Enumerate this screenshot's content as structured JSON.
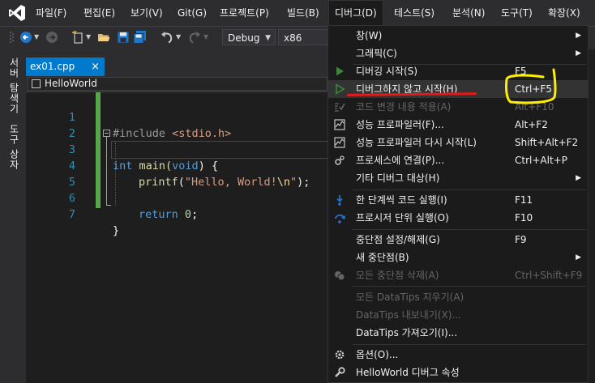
{
  "menubar": {
    "items": [
      "파일(F)",
      "편집(E)",
      "보기(V)",
      "Git(G)",
      "프로젝트(P)",
      "빌드(B)",
      "디버그(D)",
      "테스트(S)",
      "분석(N)",
      "도구(T)",
      "확장(X)"
    ],
    "active": "디버그(D)"
  },
  "toolbar": {
    "configuration": "Debug",
    "platform": "x86"
  },
  "side_panels": [
    "서버 탐색기",
    "도구 상자"
  ],
  "editor": {
    "tab_name": "ex01.cpp",
    "tab_close": "×",
    "scope": "HelloWorld",
    "line_numbers": [
      "1",
      "2",
      "3",
      "4",
      "5",
      "6",
      "7"
    ],
    "code": {
      "l1_directive": "#include ",
      "l1_header": "<stdio.h>",
      "l3_type": "int",
      "l3_name": " main(",
      "l3_void": "void",
      "l3_rest": ") {",
      "l4_fn": "printf",
      "l4_open": "(",
      "l4_str": "\"Hello, World!",
      "l4_esc": "\\n",
      "l4_strend": "\"",
      "l4_close": ");",
      "l6_ret": "return",
      "l6_num": "0",
      "l6_semi": ";",
      "l7": "}"
    }
  },
  "debug_menu": {
    "items": [
      {
        "label": "창(W)",
        "shortcut": "",
        "submenu": true,
        "disabled": false,
        "icon": ""
      },
      {
        "label": "그래픽(C)",
        "shortcut": "",
        "submenu": true,
        "disabled": false,
        "icon": ""
      },
      {
        "label": "디버깅 시작(S)",
        "shortcut": "F5",
        "submenu": false,
        "disabled": false,
        "icon": "play-icon"
      },
      {
        "label": "디버그하지 않고 시작(H)",
        "shortcut": "Ctrl+F5",
        "submenu": false,
        "disabled": false,
        "icon": "play-outline-icon",
        "highlighted": true
      },
      {
        "label": "코드 변경 내용 적용(A)",
        "shortcut": "Alt+F10",
        "submenu": false,
        "disabled": true,
        "icon": "apply-changes-icon"
      },
      {
        "label": "성능 프로파일러(F)...",
        "shortcut": "Alt+F2",
        "submenu": false,
        "disabled": false,
        "icon": "profiler-icon"
      },
      {
        "label": "성능 프로파일러 다시 시작(L)",
        "shortcut": "Shift+Alt+F2",
        "submenu": false,
        "disabled": false,
        "icon": "profiler-relaunch-icon"
      },
      {
        "label": "프로세스에 연결(P)...",
        "shortcut": "Ctrl+Alt+P",
        "submenu": false,
        "disabled": false,
        "icon": "attach-process-icon"
      },
      {
        "label": "기타 디버그 대상(H)",
        "shortcut": "",
        "submenu": true,
        "disabled": false,
        "icon": ""
      },
      {
        "label": "한 단계씩 코드 실행(I)",
        "shortcut": "F11",
        "submenu": false,
        "disabled": false,
        "icon": "step-into-icon"
      },
      {
        "label": "프로시저 단위 실행(O)",
        "shortcut": "F10",
        "submenu": false,
        "disabled": false,
        "icon": "step-over-icon"
      },
      {
        "label": "중단점 설정/해제(G)",
        "shortcut": "F9",
        "submenu": false,
        "disabled": false,
        "icon": ""
      },
      {
        "label": "새 중단점(B)",
        "shortcut": "",
        "submenu": true,
        "disabled": false,
        "icon": ""
      },
      {
        "label": "모든 중단점 삭제(A)",
        "shortcut": "Ctrl+Shift+F9",
        "submenu": false,
        "disabled": true,
        "icon": "delete-breakpoints-icon"
      },
      {
        "label": "모든 DataTips 지우기(A)",
        "shortcut": "",
        "submenu": false,
        "disabled": true,
        "icon": ""
      },
      {
        "label": "DataTips 내보내기(X)...",
        "shortcut": "",
        "submenu": false,
        "disabled": true,
        "icon": ""
      },
      {
        "label": "DataTips 가져오기(I)...",
        "shortcut": "",
        "submenu": false,
        "disabled": false,
        "icon": ""
      },
      {
        "label": "옵션(O)...",
        "shortcut": "",
        "submenu": false,
        "disabled": false,
        "icon": "gear-icon"
      },
      {
        "label": "HelloWorld 디버그 속성",
        "shortcut": "",
        "submenu": false,
        "disabled": false,
        "icon": "wrench-icon"
      }
    ],
    "submenu_glyph": "▶"
  },
  "colors": {
    "menubar_bg": "#2d2d30",
    "accent_blue": "#007acc",
    "annotation_red": "#e51919",
    "annotation_yellow": "#ffee00",
    "play_green": "#388a34"
  }
}
